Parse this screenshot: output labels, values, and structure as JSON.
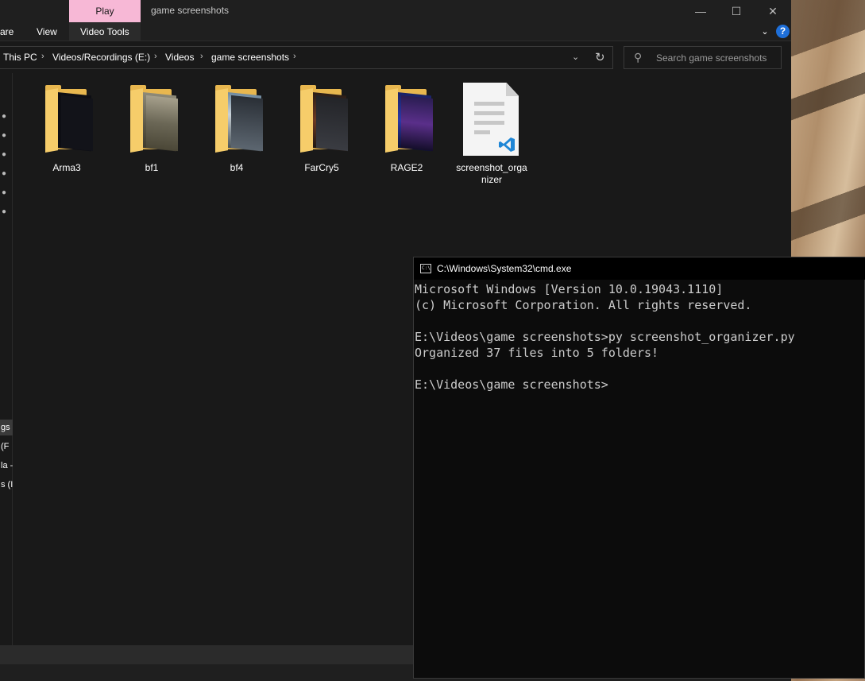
{
  "explorer": {
    "title": "game screenshots",
    "play_tab": "Play",
    "ribbon": {
      "share_partial": "are",
      "view": "View",
      "video_tools": "Video Tools"
    },
    "breadcrumb": [
      "This PC",
      "Videos/Recordings (E:)",
      "Videos",
      "game screenshots"
    ],
    "search_placeholder": "Search game screenshots",
    "nav_items": [
      "gs",
      "(F",
      "la -",
      "s (I"
    ],
    "items": [
      {
        "name": "Arma3",
        "type": "folder"
      },
      {
        "name": "bf1",
        "type": "folder"
      },
      {
        "name": "bf4",
        "type": "folder"
      },
      {
        "name": "FarCry5",
        "type": "folder"
      },
      {
        "name": "RAGE2",
        "type": "folder"
      },
      {
        "name": "screenshot_organizer",
        "name_line1": "screenshot_orga",
        "name_line2": "nizer",
        "type": "python-file"
      }
    ],
    "icons": {
      "minimize": "minimize-icon",
      "maximize": "maximize-icon",
      "close": "close-icon",
      "help": "help-icon",
      "refresh": "refresh-icon",
      "search": "search-icon",
      "pin": "pin-icon"
    },
    "colors": {
      "play_tab": "#f7b8d6",
      "folder": "#e8b74f",
      "help": "#1e6fd9"
    }
  },
  "cmd": {
    "title": "C:\\Windows\\System32\\cmd.exe",
    "lines": [
      "Microsoft Windows [Version 10.0.19043.1110]",
      "(c) Microsoft Corporation. All rights reserved.",
      "",
      "E:\\Videos\\game screenshots>py screenshot_organizer.py",
      "Organized 37 files into 5 folders!",
      "",
      "E:\\Videos\\game screenshots>"
    ]
  }
}
